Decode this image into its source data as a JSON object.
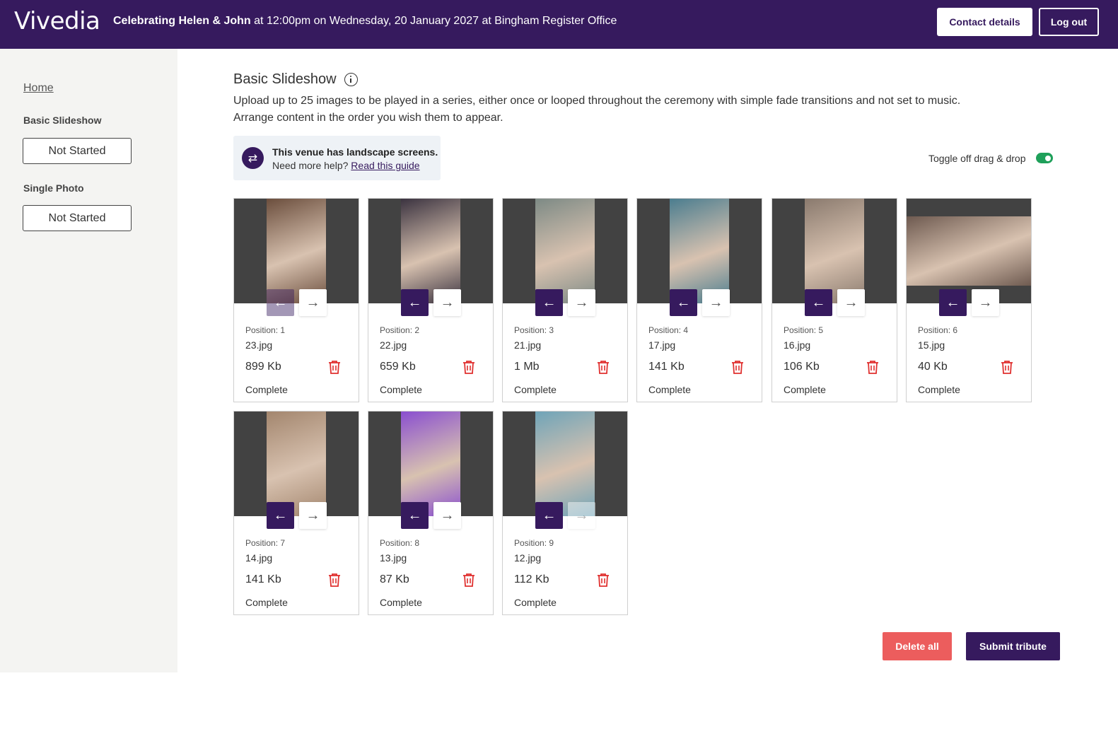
{
  "header": {
    "logo": "Vivedia",
    "event_bold": "Celebrating Helen & John",
    "event_rest": "at 12:00pm on Wednesday, 20 January 2027 at Bingham Register Office",
    "contact_label": "Contact details",
    "logout_label": "Log out",
    "brand_color": "#361a5e"
  },
  "sidebar": {
    "home_label": "Home",
    "sections": [
      {
        "heading": "Basic Slideshow",
        "status": "Not Started"
      },
      {
        "heading": "Single Photo",
        "status": "Not Started"
      }
    ]
  },
  "main": {
    "title": "Basic Slideshow",
    "description_line1": "Upload up to 25 images to be played in a series, either once or looped throughout the ceremony with simple fade transitions and not set to music.",
    "description_line2": "Arrange content in the order you wish them to appear.",
    "venue_notice": {
      "title": "This venue has landscape screens.",
      "help_prefix": "Need more help?",
      "help_link": "Read this guide"
    },
    "toggle_label": "Toggle off drag & drop",
    "toggle_on": true,
    "prev_arrow": "←",
    "next_arrow": "→",
    "swap_icon": "⇄",
    "cards": [
      {
        "position": "Position: 1",
        "filename": "23.jpg",
        "size": "899 Kb",
        "status": "Complete",
        "orientation": "portrait",
        "photo_color": "#6b4e3d"
      },
      {
        "position": "Position: 2",
        "filename": "22.jpg",
        "size": "659 Kb",
        "status": "Complete",
        "orientation": "portrait",
        "photo_color": "#3b3340"
      },
      {
        "position": "Position: 3",
        "filename": "21.jpg",
        "size": "1 Mb",
        "status": "Complete",
        "orientation": "portrait",
        "photo_color": "#7d8a85"
      },
      {
        "position": "Position: 4",
        "filename": "17.jpg",
        "size": "141 Kb",
        "status": "Complete",
        "orientation": "portrait",
        "photo_color": "#4b7d8f"
      },
      {
        "position": "Position: 5",
        "filename": "16.jpg",
        "size": "106 Kb",
        "status": "Complete",
        "orientation": "portrait",
        "photo_color": "#8a7a6e"
      },
      {
        "position": "Position: 6",
        "filename": "15.jpg",
        "size": "40 Kb",
        "status": "Complete",
        "orientation": "landscape",
        "photo_color": "#6e5a50"
      },
      {
        "position": "Position: 7",
        "filename": "14.jpg",
        "size": "141 Kb",
        "status": "Complete",
        "orientation": "portrait",
        "photo_color": "#a3866e"
      },
      {
        "position": "Position: 8",
        "filename": "13.jpg",
        "size": "87 Kb",
        "status": "Complete",
        "orientation": "portrait",
        "photo_color": "#8a4fd0"
      },
      {
        "position": "Position: 9",
        "filename": "12.jpg",
        "size": "112 Kb",
        "status": "Complete",
        "orientation": "portrait",
        "photo_color": "#6fa4b8"
      }
    ],
    "delete_all_label": "Delete all",
    "submit_label": "Submit tribute"
  },
  "colors": {
    "delete": "#ec5d5d",
    "trash_icon": "#e0302f",
    "toggle": "#1fa05a"
  }
}
